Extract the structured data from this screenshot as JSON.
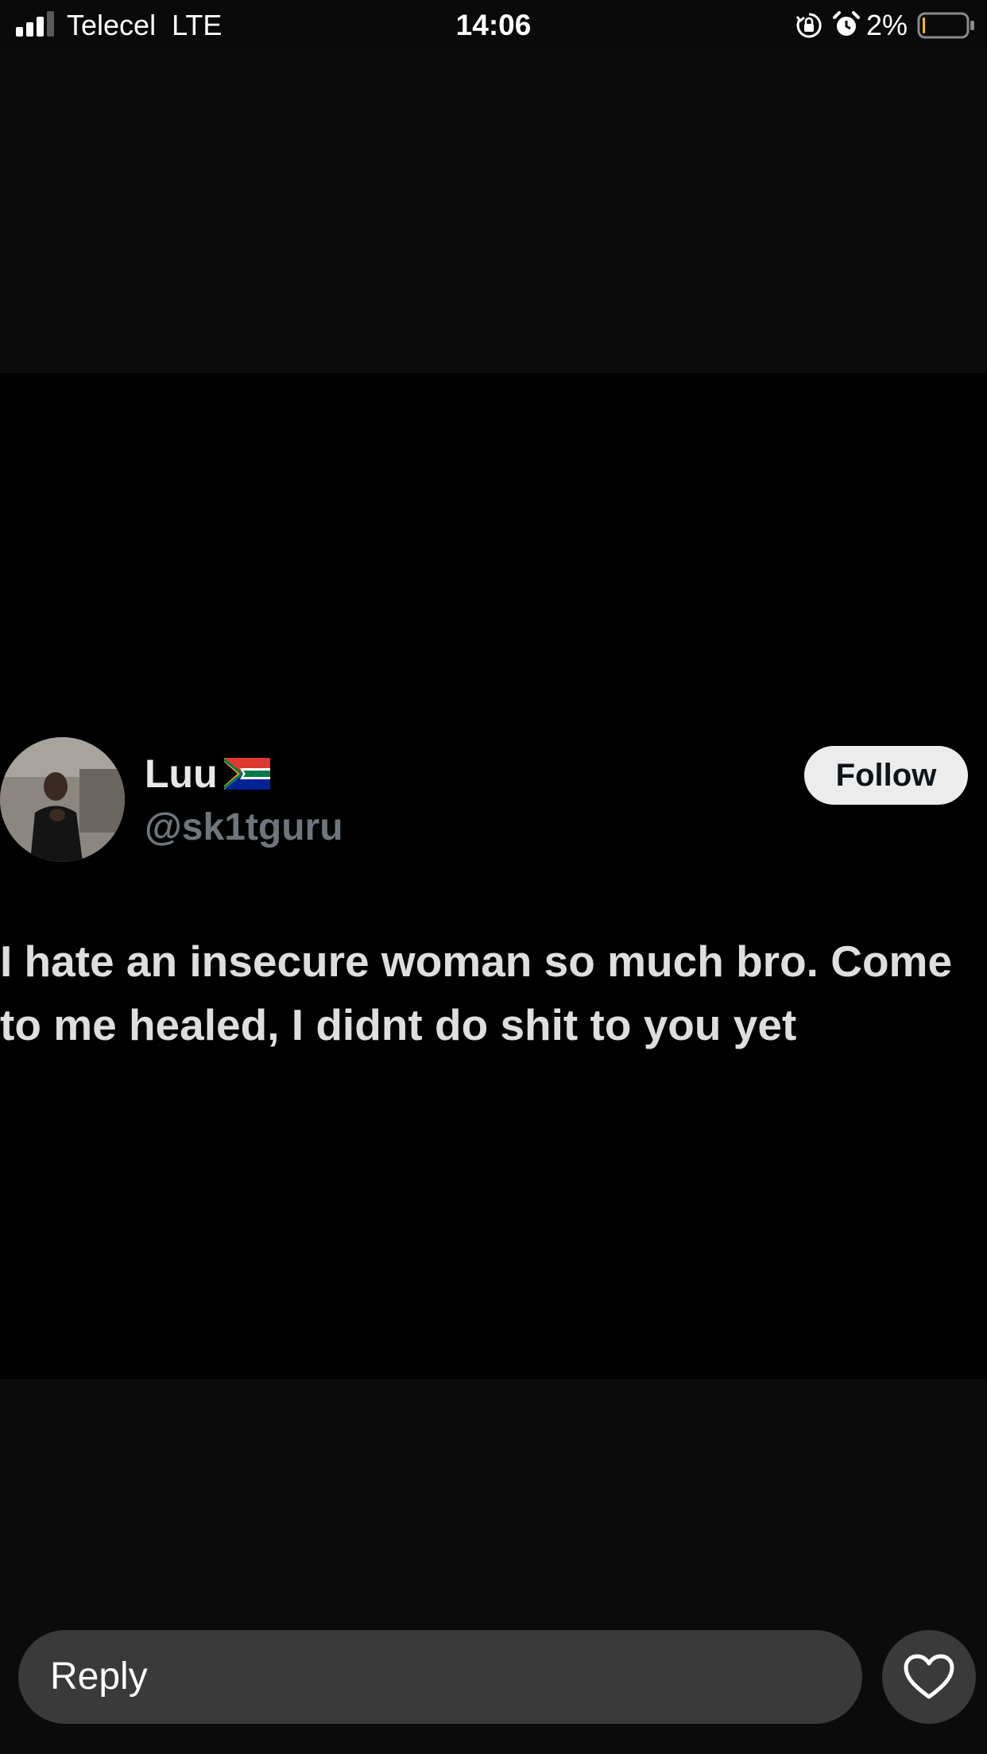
{
  "status_bar": {
    "carrier": "Telecel",
    "network": "LTE",
    "time": "14:06",
    "battery_percent": "2%",
    "icons": [
      "signal-icon",
      "orientation-lock-icon",
      "alarm-icon",
      "battery-icon"
    ],
    "battery_level": 0.02
  },
  "tweet": {
    "display_name": "Luu",
    "flag_icon": "south-africa-flag-icon",
    "handle": "@sk1tguru",
    "follow_label": "Follow",
    "text": "I hate an insecure woman so much bro. Come to me healed, I didnt do shit to you yet"
  },
  "reply_bar": {
    "placeholder": "Reply",
    "like_icon": "heart-icon"
  },
  "colors": {
    "background": "#000000",
    "band": "#0b0b0b",
    "input_bg": "#3a3a3a",
    "handle_gray": "#6f757b",
    "follow_bg": "#ececec"
  }
}
